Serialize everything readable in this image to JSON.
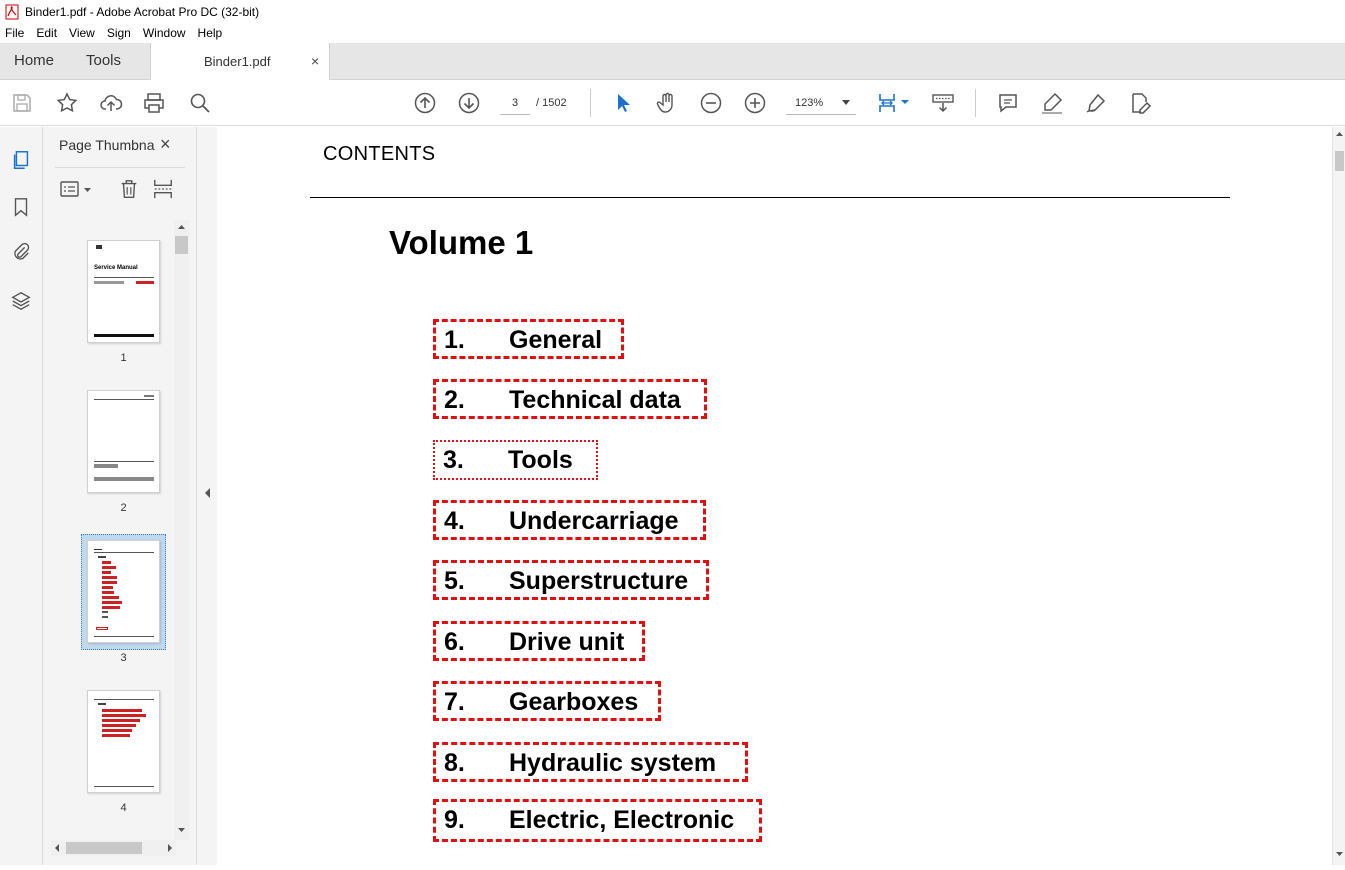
{
  "window": {
    "title": "Binder1.pdf - Adobe Acrobat Pro DC (32-bit)"
  },
  "menu": [
    "File",
    "Edit",
    "View",
    "Sign",
    "Window",
    "Help"
  ],
  "nav_tabs": {
    "home": "Home",
    "tools": "Tools"
  },
  "document_tab": {
    "label": "Binder1.pdf",
    "close": "×"
  },
  "toolbar": {
    "current_page": "3",
    "page_total": "/ 1502",
    "zoom": "123%"
  },
  "left_rail": {
    "icons": [
      "page-thumbnails-icon",
      "bookmark-icon",
      "attachment-icon",
      "layers-icon"
    ]
  },
  "thumbnail_panel": {
    "title": "Page Thumbnails",
    "close": "×",
    "thumbnails": [
      {
        "page": "1",
        "heading": "Service Manual"
      },
      {
        "page": "2"
      },
      {
        "page": "3",
        "selected": true
      },
      {
        "page": "4"
      }
    ]
  },
  "document": {
    "header": "CONTENTS",
    "volume_title": "Volume 1",
    "entries": [
      {
        "number": "1.",
        "title": "General"
      },
      {
        "number": "2.",
        "title": "Technical data"
      },
      {
        "number": "3.",
        "title": "Tools"
      },
      {
        "number": "4.",
        "title": "Undercarriage"
      },
      {
        "number": "5.",
        "title": "Superstructure"
      },
      {
        "number": "6.",
        "title": "Drive unit"
      },
      {
        "number": "7.",
        "title": "Gearboxes"
      },
      {
        "number": "8.",
        "title": "Hydraulic system"
      },
      {
        "number": "9.",
        "title": "Electric, Electronic"
      }
    ]
  },
  "colors": {
    "link_box": "#e01010",
    "accent_blue": "#1a73c8",
    "chrome_bg": "#f4f4f4",
    "tabbar_bg": "#e6e6e6"
  }
}
